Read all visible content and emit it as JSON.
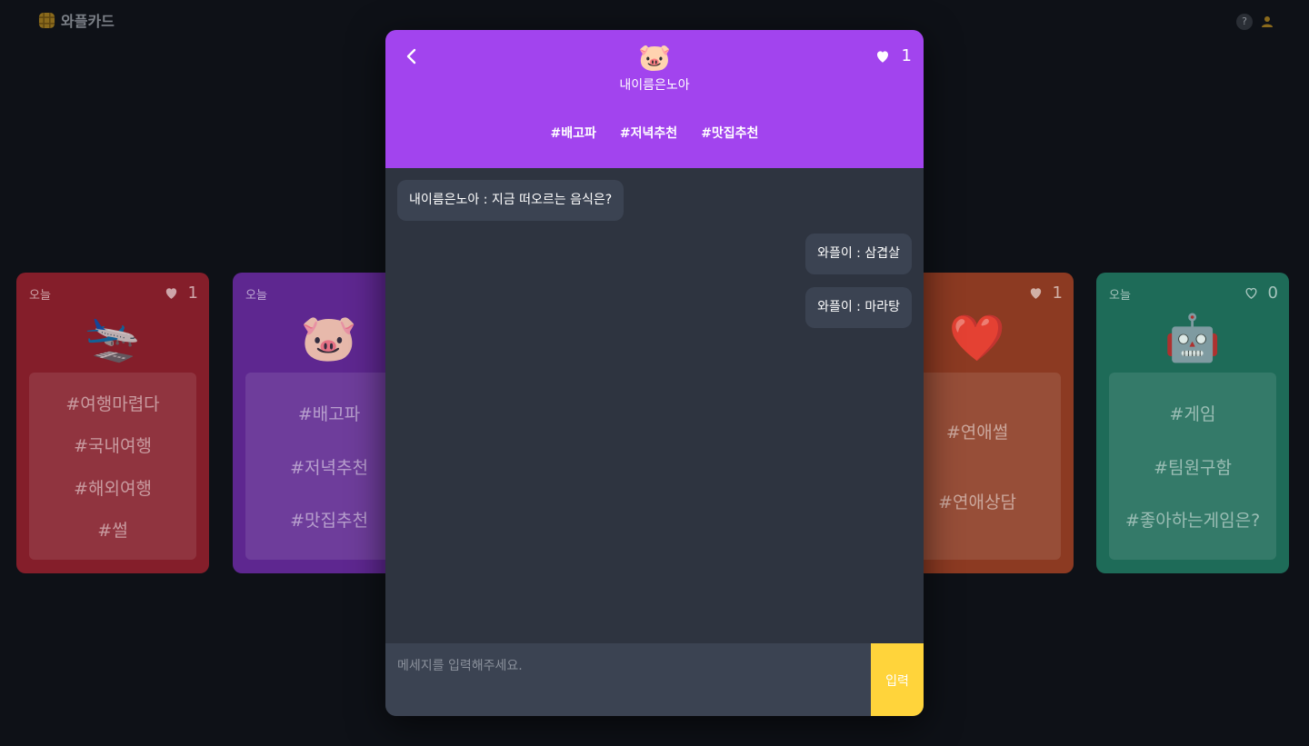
{
  "header": {
    "logo_text": "와플카드",
    "help_text": "?"
  },
  "cards": [
    {
      "date": "오늘",
      "likes": "1",
      "liked": true,
      "emoji": "🛬",
      "tags": [
        "#여행마렵다",
        "#국내여행",
        "#해외여행",
        "#썰"
      ],
      "color": "#841e2a"
    },
    {
      "date": "오늘",
      "emoji": "🐷",
      "tags": [
        "#배고파",
        "#저녁추천",
        "#맛집추천"
      ],
      "color": "#5e2790"
    },
    {
      "likes": "1",
      "liked": true,
      "emoji": "❤️",
      "tags": [
        "#연애썰",
        "#연애상담"
      ],
      "color": "#8c3a22"
    },
    {
      "date": "오늘",
      "likes": "0",
      "liked": false,
      "emoji": "🤖",
      "tags": [
        "#게임",
        "#팀원구함",
        "#좋아하는게임은?"
      ],
      "color": "#1e6b58"
    }
  ],
  "modal": {
    "emoji": "🐷",
    "room_name": "내이름은노아",
    "likes": "1",
    "tags": [
      "#배고파",
      "#저녁추천",
      "#맛집추천"
    ],
    "header_color": "#a244ee",
    "messages": [
      {
        "side": "left",
        "text": "내이름은노아 : 지금 떠오르는 음식은?"
      },
      {
        "side": "right",
        "text": "와플이 : 삼겹살"
      },
      {
        "side": "right",
        "text": "와플이 : 마라탕"
      }
    ],
    "input_placeholder": "메세지를 입력해주세요.",
    "send_label": "입력",
    "send_color": "#ffd43b"
  }
}
